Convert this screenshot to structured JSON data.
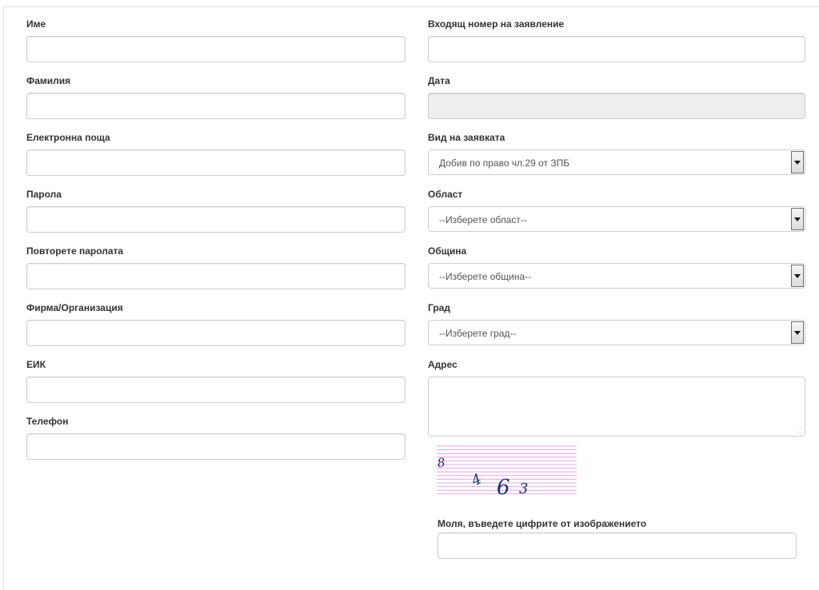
{
  "left_fields": [
    {
      "label": "Име",
      "value": ""
    },
    {
      "label": "Фамилия",
      "value": ""
    },
    {
      "label": "Електронна поща",
      "value": ""
    },
    {
      "label": "Парола",
      "value": ""
    },
    {
      "label": "Повторете паролата",
      "value": ""
    },
    {
      "label": "Фирма/Организация",
      "value": ""
    },
    {
      "label": "ЕИК",
      "value": ""
    },
    {
      "label": "Телефон",
      "value": ""
    }
  ],
  "right": {
    "incoming_number": {
      "label": "Входящ номер на заявление",
      "value": ""
    },
    "date": {
      "label": "Дата",
      "value": ""
    },
    "request_type": {
      "label": "Вид на заявката",
      "selected": "Добив по право чл.29 от ЗПБ"
    },
    "region": {
      "label": "Област",
      "selected": "--Изберете област--"
    },
    "municipality": {
      "label": "Община",
      "selected": "--Изберете община--"
    },
    "city": {
      "label": "Град",
      "selected": "--Изберете град--"
    },
    "address": {
      "label": "Адрес",
      "value": ""
    }
  },
  "captcha": {
    "chars": [
      "8",
      "4",
      "6",
      "3"
    ],
    "line_color": "#e3a6e6",
    "label": "Моля, въведете цифрите от изображението",
    "value": ""
  }
}
